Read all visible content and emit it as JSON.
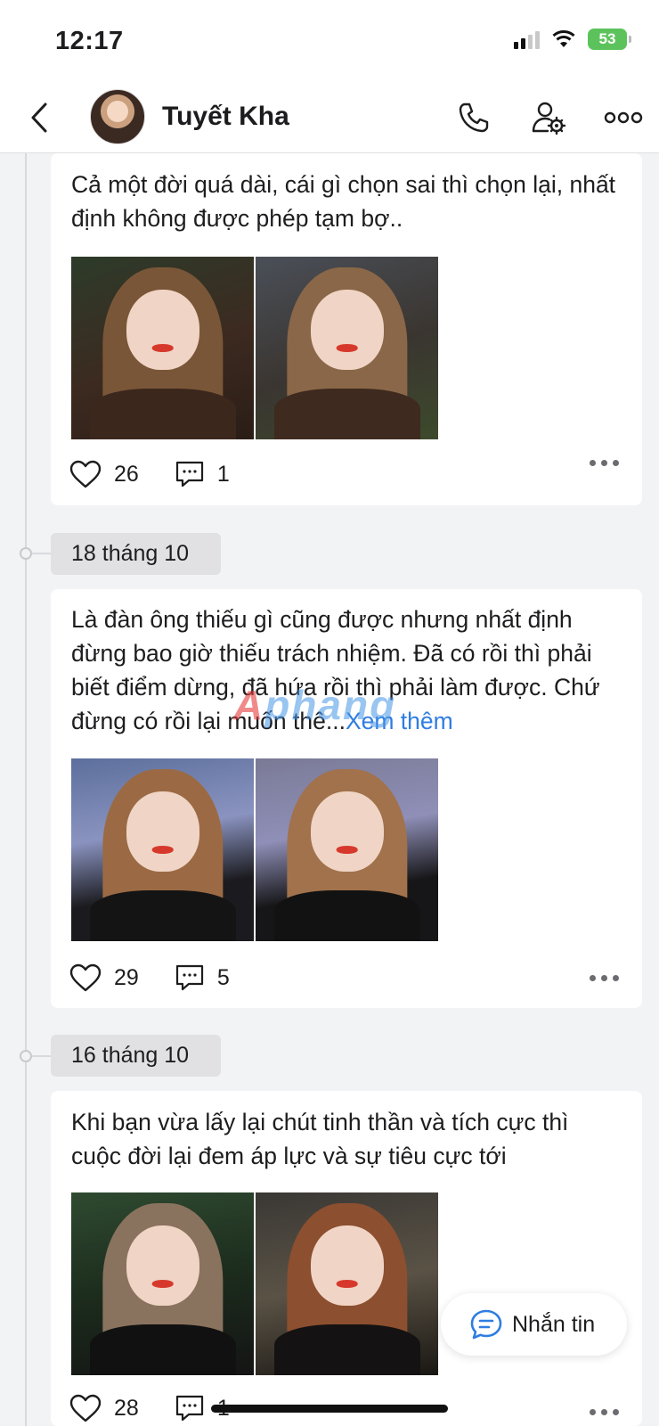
{
  "status": {
    "time": "12:17",
    "battery": "53"
  },
  "header": {
    "title": "Tuyết Kha"
  },
  "posts": [
    {
      "text": "Cả một đời quá dài, cái gì chọn sai thì chọn lại, nhất định không được phép tạm bợ..",
      "likes": "26",
      "comments": "1"
    },
    {
      "date": "18 tháng 10",
      "text": "Là đàn ông thiếu gì cũng được nhưng nhất định đừng bao giờ thiếu trách nhiệm. Đã có rồi thì phải biết điểm dừng, đã hứa rồi thì phải làm được. Chứ đừng có rồi lại muốn thê...",
      "see_more": "Xem thêm",
      "likes": "29",
      "comments": "5"
    },
    {
      "date": "16 tháng 10",
      "text": "Khi bạn vừa lấy lại chút tinh thần và tích cực thì cuộc đời lại đem áp lực và sự tiêu cực tới",
      "likes": "28",
      "comments": "1"
    }
  ],
  "watermark": {
    "part1": "A",
    "part2": "phang"
  },
  "fab": {
    "label": "Nhắn tin"
  },
  "colors": {
    "accent": "#2f7de1",
    "background": "#f2f3f5",
    "battery": "#5cc35c"
  },
  "icons": [
    "back-chevron-icon",
    "phone-icon",
    "user-settings-icon",
    "more-icon",
    "heart-icon",
    "comment-icon",
    "chat-bubble-icon"
  ]
}
